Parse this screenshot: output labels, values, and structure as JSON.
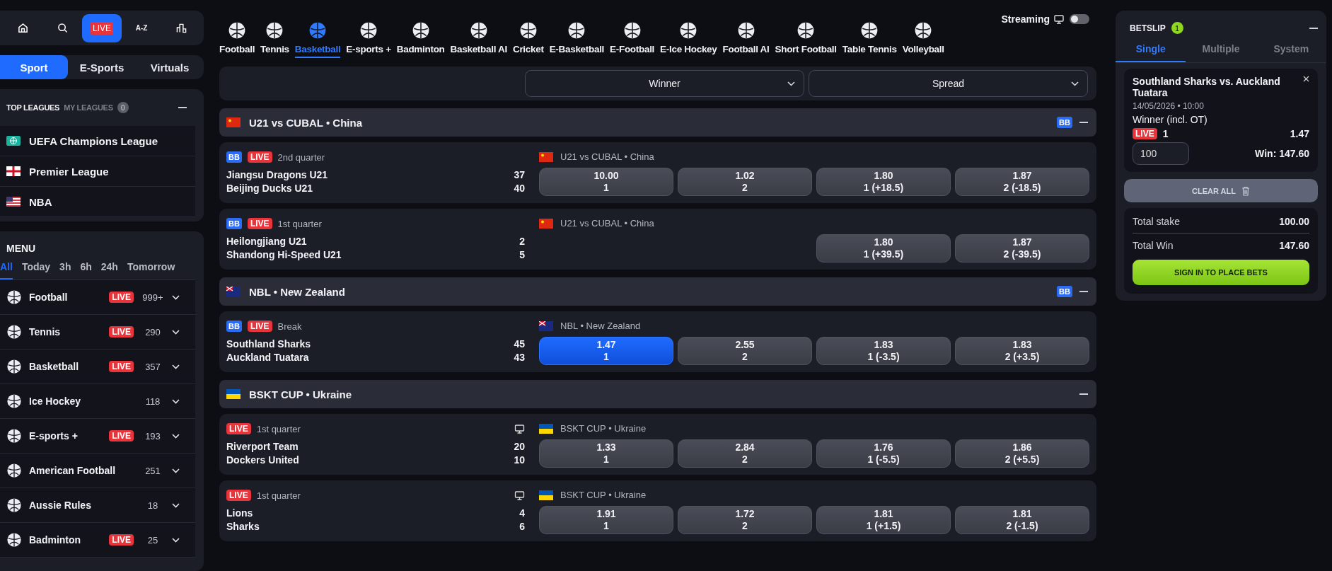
{
  "top_nav": [
    {
      "kind": "home",
      "selected": false
    },
    {
      "kind": "search",
      "selected": false
    },
    {
      "kind": "live",
      "label": "LIVE",
      "selected": true
    },
    {
      "kind": "text",
      "label": "A-Z",
      "selected": false
    },
    {
      "kind": "stats",
      "selected": false
    }
  ],
  "section_tabs": [
    {
      "label": "Sport",
      "selected": true
    },
    {
      "label": "E-Sports",
      "selected": false
    },
    {
      "label": "Virtuals",
      "selected": false
    }
  ],
  "top_leagues": {
    "tabs": [
      {
        "label": "TOP LEAGUES",
        "selected": true
      },
      {
        "label": "MY LEAGUES",
        "selected": false,
        "count": "0"
      }
    ],
    "items": [
      {
        "name": "UEFA Champions League",
        "flag": {
          "kind": "globe"
        }
      },
      {
        "name": "Premier League",
        "flag": {
          "kind": "england"
        }
      },
      {
        "name": "NBA",
        "flag": {
          "kind": "usa"
        }
      }
    ]
  },
  "menu": {
    "title": "MENU",
    "filters": [
      {
        "label": "All",
        "selected": true
      },
      {
        "label": "Today",
        "selected": false
      },
      {
        "label": "3h",
        "selected": false
      },
      {
        "label": "6h",
        "selected": false
      },
      {
        "label": "24h",
        "selected": false
      },
      {
        "label": "Tomorrow",
        "selected": false
      }
    ],
    "sports": [
      {
        "name": "Football",
        "live_badge": "LIVE",
        "count": "999+"
      },
      {
        "name": "Tennis",
        "live_badge": "LIVE",
        "count": "290"
      },
      {
        "name": "Basketball",
        "live_badge": "LIVE",
        "count": "357"
      },
      {
        "name": "Ice Hockey",
        "count": "118"
      },
      {
        "name": "E-sports +",
        "live_badge": "LIVE",
        "count": "193"
      },
      {
        "name": "American Football",
        "count": "251"
      },
      {
        "name": "Aussie Rules",
        "count": "18"
      },
      {
        "name": "Badminton",
        "live_badge": "LIVE",
        "count": "25"
      }
    ]
  },
  "sport_tabs": [
    {
      "label": "Football",
      "selected": false
    },
    {
      "label": "Tennis",
      "selected": false
    },
    {
      "label": "Basketball",
      "selected": true
    },
    {
      "label": "E-sports +",
      "selected": false
    },
    {
      "label": "Badminton",
      "selected": false
    },
    {
      "label": "Basketball AI",
      "selected": false
    },
    {
      "label": "Cricket",
      "selected": false
    },
    {
      "label": "E-Basketball",
      "selected": false
    },
    {
      "label": "E-Football",
      "selected": false
    },
    {
      "label": "E-Ice Hockey",
      "selected": false
    },
    {
      "label": "Football AI",
      "selected": false
    },
    {
      "label": "Short Football",
      "selected": false
    },
    {
      "label": "Table Tennis",
      "selected": false
    },
    {
      "label": "Volleyball",
      "selected": false
    }
  ],
  "streaming": {
    "label": "Streaming",
    "on": false
  },
  "markets": [
    "Winner",
    "Spread"
  ],
  "leagues": [
    {
      "name": "U21 vs CUBAL • China",
      "flag": {
        "kind": "cn"
      },
      "badge": "BB",
      "events": [
        {
          "badge": "BB",
          "live": "LIVE",
          "period": "2nd quarter",
          "stream": false,
          "league": "U21 vs CUBAL • China",
          "flag": {
            "kind": "cn"
          },
          "home": "Jiangsu Dragons U21",
          "away": "Beijing Ducks U21",
          "home_score": "37",
          "away_score": "40",
          "winner": [
            {
              "price": "10.00",
              "label": "1",
              "selected": false
            },
            {
              "price": "1.02",
              "label": "2",
              "selected": false
            }
          ],
          "spread": [
            {
              "price": "1.80",
              "label": "1 (+18.5)",
              "selected": false
            },
            {
              "price": "1.87",
              "label": "2 (-18.5)",
              "selected": false
            }
          ]
        },
        {
          "badge": "BB",
          "live": "LIVE",
          "period": "1st quarter",
          "stream": false,
          "league": "U21 vs CUBAL • China",
          "flag": {
            "kind": "cn"
          },
          "home": "Heilongjiang U21",
          "away": "Shandong Hi-Speed U21",
          "home_score": "2",
          "away_score": "5",
          "spread": [
            {
              "price": "1.80",
              "label": "1 (+39.5)",
              "selected": false
            },
            {
              "price": "1.87",
              "label": "2 (-39.5)",
              "selected": false
            }
          ]
        }
      ]
    },
    {
      "name": "NBL • New Zealand",
      "flag": {
        "kind": "nz"
      },
      "badge": "BB",
      "events": [
        {
          "badge": "BB",
          "live": "LIVE",
          "period": "Break",
          "stream": false,
          "league": "NBL • New Zealand",
          "flag": {
            "kind": "nz"
          },
          "home": "Southland Sharks",
          "away": "Auckland Tuatara",
          "home_score": "45",
          "away_score": "43",
          "winner": [
            {
              "price": "1.47",
              "label": "1",
              "selected": true
            },
            {
              "price": "2.55",
              "label": "2",
              "selected": false
            }
          ],
          "spread": [
            {
              "price": "1.83",
              "label": "1 (-3.5)",
              "selected": false
            },
            {
              "price": "1.83",
              "label": "2 (+3.5)",
              "selected": false
            }
          ]
        }
      ]
    },
    {
      "name": "BSKT CUP • Ukraine",
      "flag": {
        "kind": "ua"
      },
      "events": [
        {
          "live": "LIVE",
          "period": "1st quarter",
          "stream": true,
          "league": "BSKT CUP • Ukraine",
          "flag": {
            "kind": "ua"
          },
          "home": "Riverport Team",
          "away": "Dockers United",
          "home_score": "20",
          "away_score": "10",
          "winner": [
            {
              "price": "1.33",
              "label": "1",
              "selected": false
            },
            {
              "price": "2.84",
              "label": "2",
              "selected": false
            }
          ],
          "spread": [
            {
              "price": "1.76",
              "label": "1 (-5.5)",
              "selected": false
            },
            {
              "price": "1.86",
              "label": "2 (+5.5)",
              "selected": false
            }
          ]
        },
        {
          "live": "LIVE",
          "period": "1st quarter",
          "stream": true,
          "league": "BSKT CUP • Ukraine",
          "flag": {
            "kind": "ua"
          },
          "home": "Lions",
          "away": "Sharks",
          "home_score": "4",
          "away_score": "6",
          "winner": [
            {
              "price": "1.91",
              "label": "1",
              "selected": false
            },
            {
              "price": "1.72",
              "label": "2",
              "selected": false
            }
          ],
          "spread": [
            {
              "price": "1.81",
              "label": "1 (+1.5)",
              "selected": false
            },
            {
              "price": "1.81",
              "label": "2 (-1.5)",
              "selected": false
            }
          ]
        }
      ]
    }
  ],
  "betslip": {
    "title": "BETSLIP",
    "count": "1",
    "tabs": [
      {
        "label": "Single",
        "selected": true
      },
      {
        "label": "Multiple",
        "selected": false
      },
      {
        "label": "System",
        "selected": false
      }
    ],
    "bet": {
      "match": "Southland Sharks vs. Auckland Tuatara",
      "date": "14/05/2026 • 10:00",
      "market": "Winner (incl. OT)",
      "live": "LIVE",
      "pick": "1",
      "odds": "1.47",
      "stake": "100",
      "win_label": "Win:",
      "win": "147.60"
    },
    "clear_all": "CLEAR ALL",
    "totals": [
      {
        "label": "Total stake",
        "value": "100.00"
      },
      {
        "label": "Total Win",
        "value": "147.60"
      }
    ],
    "cta": "SIGN IN TO PLACE BETS"
  }
}
